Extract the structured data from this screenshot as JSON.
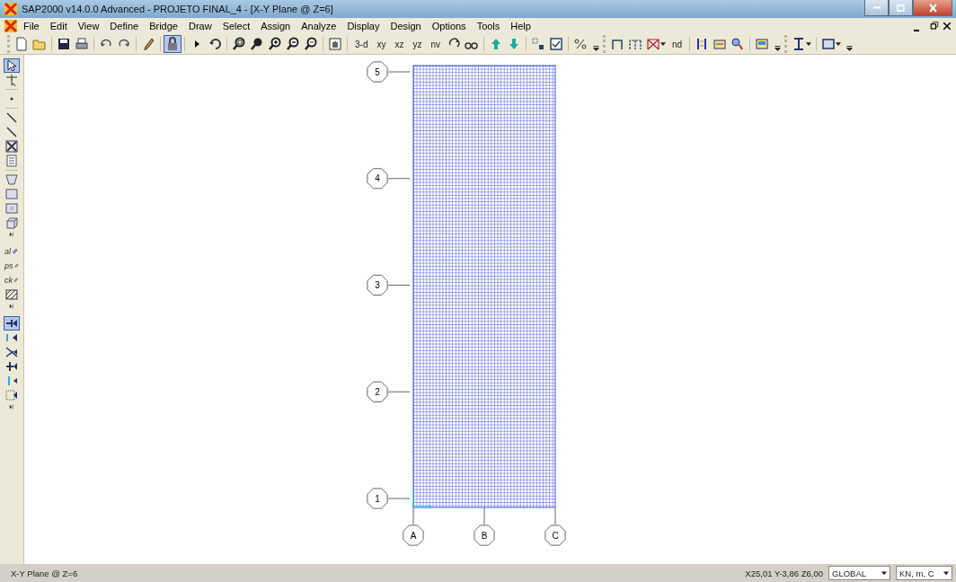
{
  "window": {
    "title": "SAP2000 v14.0.0 Advanced  - PROJETO FINAL_4 - [X-Y Plane @ Z=6]"
  },
  "menu": [
    "File",
    "Edit",
    "View",
    "Define",
    "Bridge",
    "Draw",
    "Select",
    "Assign",
    "Analyze",
    "Display",
    "Design",
    "Options",
    "Tools",
    "Help"
  ],
  "toolbar_groups": [
    [
      {
        "selected": false
      },
      {
        "selected": false
      },
      {
        "selected": false
      },
      {
        "selected": false
      },
      {
        "selected": false
      },
      {
        "selected": false
      },
      {
        "selected": false
      },
      {
        "selected": true
      },
      {
        "selected": false
      },
      {
        "selected": false
      },
      {
        "selected": false
      },
      {
        "selected": false
      },
      {
        "selected": false
      },
      {
        "selected": false
      },
      {
        "selected": false
      },
      {
        "selected": false
      },
      {
        "label": "3-d",
        "selected": false
      },
      {
        "label": "xy",
        "selected": false
      },
      {
        "label": "xz",
        "selected": false
      },
      {
        "label": "yz",
        "selected": false
      },
      {
        "label": "nv",
        "selected": false
      },
      {
        "selected": false
      },
      {
        "selected": false
      },
      {
        "selected": false
      },
      {
        "selected": false
      },
      {
        "selected": false
      },
      {
        "selected": false
      },
      {
        "selected": false
      }
    ],
    [
      {
        "selected": false
      },
      {
        "selected": false
      },
      {
        "selected": false
      },
      {
        "label": "nd",
        "selected": false
      },
      {
        "selected": false
      },
      {
        "selected": false
      },
      {
        "selected": false
      },
      {
        "selected": false
      }
    ],
    [
      {
        "selected": false
      },
      {
        "selected": false
      }
    ]
  ],
  "left_tools": [
    {
      "selected": true
    },
    {
      "selected": false
    },
    {
      "selected": false
    },
    {
      "selected": false
    },
    {
      "selected": false
    },
    {
      "selected": false
    },
    {
      "selected": false
    },
    {
      "selected": false
    },
    {
      "selected": false
    },
    {
      "selected": false
    },
    {
      "selected": false
    },
    {
      "label": "al",
      "selected": false
    },
    {
      "label": "ps",
      "selected": false
    },
    {
      "label": "ck",
      "selected": false
    },
    {
      "selected": false
    },
    {
      "selected": true
    },
    {
      "selected": false
    },
    {
      "selected": false
    },
    {
      "selected": false
    },
    {
      "selected": false
    },
    {
      "selected": false
    }
  ],
  "grid": {
    "rows": [
      "5",
      "4",
      "3",
      "2",
      "1"
    ],
    "columns": [
      "A",
      "B",
      "C"
    ]
  },
  "status_bar": {
    "view": "X-Y Plane @ Z=6",
    "coordinates": "X25,01 Y-3,86 Z6,00",
    "coordinate_system": "GLOBAL",
    "units": "KN, m, C"
  }
}
